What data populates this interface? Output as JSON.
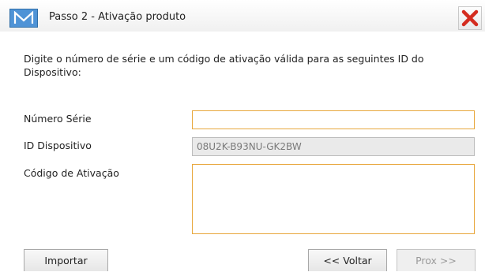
{
  "window": {
    "title": "Passo 2 - Ativação produto",
    "logo_icon": "m-logo-icon",
    "close_icon": "red-x-close-icon",
    "accent_color": "#e8a73c"
  },
  "form": {
    "instructions": "Digite o número de série e um código de ativação válida para as seguintes ID do Dispositivo:",
    "serial": {
      "label": "Número Série",
      "value": ""
    },
    "device_id": {
      "label": "ID Dispositivo",
      "value": "08U2K-B93NU-GK2BW"
    },
    "activation_code": {
      "label": "Código de Ativação",
      "value": ""
    }
  },
  "buttons": {
    "import_label": "Importar",
    "back_label": "<< Voltar",
    "next_label": "Prox >>"
  }
}
